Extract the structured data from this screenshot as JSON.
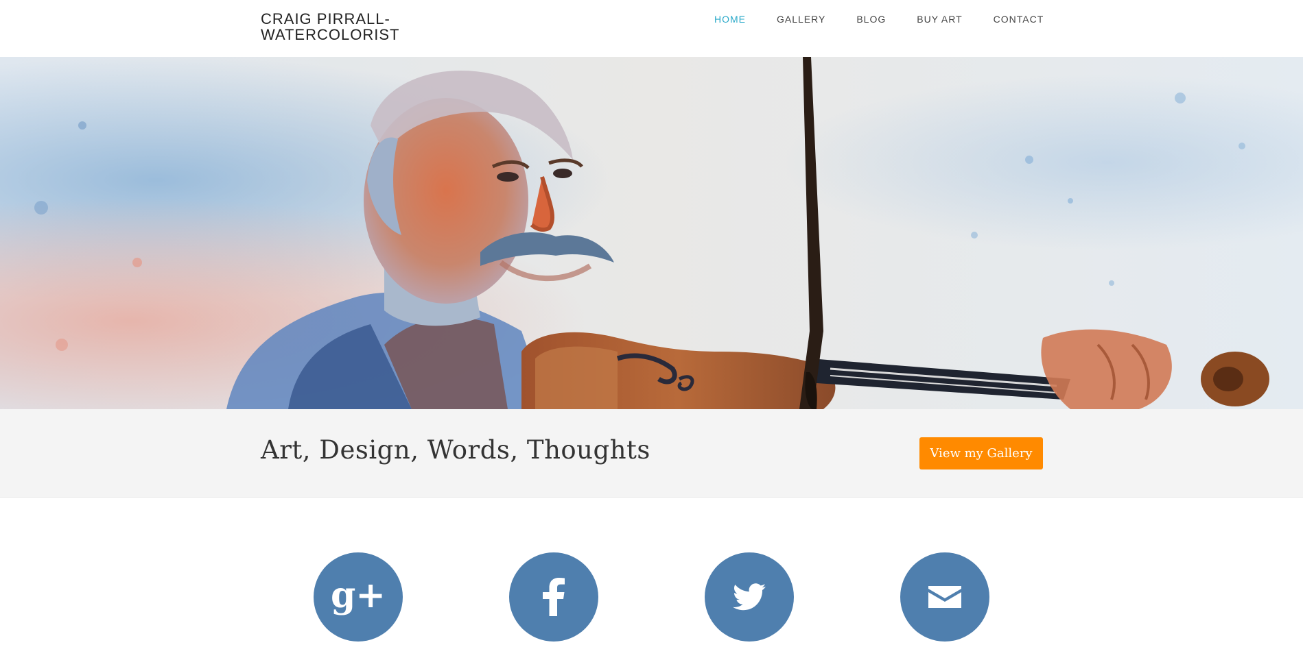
{
  "header": {
    "brand": "CRAIG PIRRALL-WATERCOLORIST",
    "nav": [
      {
        "label": "HOME",
        "active": true
      },
      {
        "label": "GALLERY",
        "active": false
      },
      {
        "label": "BLOG",
        "active": false
      },
      {
        "label": "BUY ART",
        "active": false
      },
      {
        "label": "CONTACT",
        "active": false
      }
    ]
  },
  "hero": {
    "image": "watercolor-painting-violinist"
  },
  "band": {
    "tagline": "Art, Design, Words, Thoughts",
    "cta_label": "View my Gallery"
  },
  "social": [
    {
      "icon": "google-plus-icon",
      "glyph": "g+"
    },
    {
      "icon": "facebook-icon"
    },
    {
      "icon": "twitter-icon"
    },
    {
      "icon": "email-icon"
    }
  ],
  "colors": {
    "accent_nav": "#2aa9c9",
    "cta": "#ff8a00",
    "social": "#4f7fae",
    "band_bg": "#f4f4f4"
  }
}
